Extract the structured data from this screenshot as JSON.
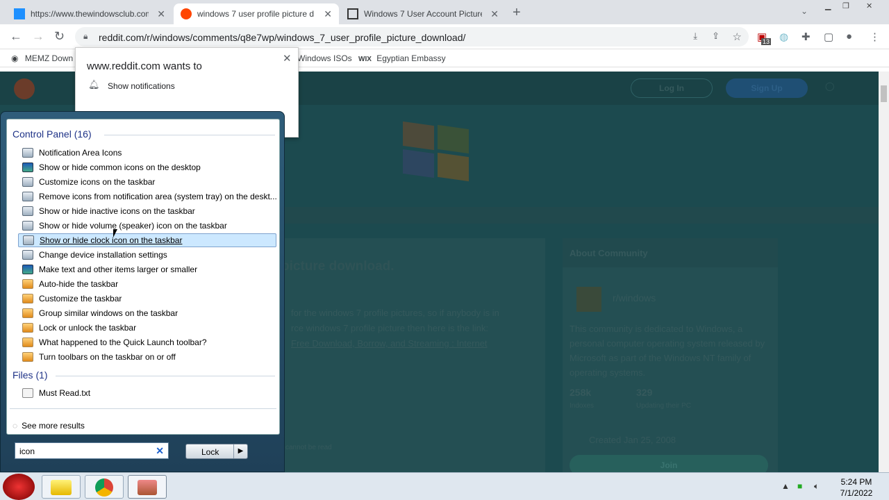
{
  "browser": {
    "tabs": [
      {
        "title": "https://www.thewindowsclub.com",
        "icon": "windows-club-favicon"
      },
      {
        "title": "windows 7 user profile picture d",
        "icon": "reddit-favicon"
      },
      {
        "title": "Windows 7 User Account Picture",
        "icon": "library-favicon"
      }
    ],
    "url": "reddit.com/r/windows/comments/q8e7wp/windows_7_user_profile_picture_download/",
    "bookmarks": [
      "MEMZ Down",
      "Windows ISOs",
      "Egyptian Embassy"
    ],
    "extension_badge": "13"
  },
  "notification_prompt": {
    "title": "www.reddit.com wants to",
    "text": "Show notifications"
  },
  "page_bg": {
    "login": "Log In",
    "signup": "Sign Up",
    "post_title": "picture download.",
    "about_header": "About Community",
    "community": "r/windows",
    "description": "This community is dedicated to Windows, a personal computer operating system released by Microsoft as part of the Windows NT family of operating systems.",
    "members": "258k",
    "members_label": "Indoxes",
    "online": "329",
    "online_label": "Updating their PC",
    "created": "Created Jan 25, 2008",
    "join": "Join",
    "body1": "for the windows 7 profile pictures, so if anybody is in",
    "body2": "rce windows 7 profile picture then here is the link:",
    "body3": "Free Download, Borrow, and Streaming : Internet",
    "cannot": "cannot be read"
  },
  "start_menu": {
    "group1": "Control Panel (16)",
    "items": [
      {
        "label": "Notification Area Icons",
        "icon": "cp"
      },
      {
        "label": "Show or hide common icons on the desktop",
        "icon": "dk"
      },
      {
        "label": "Customize icons on the taskbar",
        "icon": "cp"
      },
      {
        "label": "Remove icons from notification area (system tray) on the deskt...",
        "icon": "cp"
      },
      {
        "label": "Show or hide inactive icons on the taskbar",
        "icon": "cp"
      },
      {
        "label": "Show or hide volume (speaker) icon on the taskbar",
        "icon": "cp"
      },
      {
        "label": "Show or hide clock icon on the taskbar",
        "icon": "cp",
        "selected": true
      },
      {
        "label": "Change device installation settings",
        "icon": "cp"
      },
      {
        "label": "Make text and other items larger or smaller",
        "icon": "dk"
      },
      {
        "label": "Auto-hide the taskbar",
        "icon": "tb"
      },
      {
        "label": "Customize the taskbar",
        "icon": "tb"
      },
      {
        "label": "Group similar windows on the taskbar",
        "icon": "tb"
      },
      {
        "label": "Lock or unlock the taskbar",
        "icon": "tb"
      },
      {
        "label": "What happened to the Quick Launch toolbar?",
        "icon": "tb"
      },
      {
        "label": "Turn toolbars on the taskbar on or off",
        "icon": "tb"
      }
    ],
    "group2": "Files (1)",
    "file": "Must Read.txt",
    "see_more": "See more results",
    "search_value": "icon",
    "lock_label": "Lock"
  },
  "taskbar": {
    "time": "5:24 PM",
    "date": "7/1/2022"
  }
}
